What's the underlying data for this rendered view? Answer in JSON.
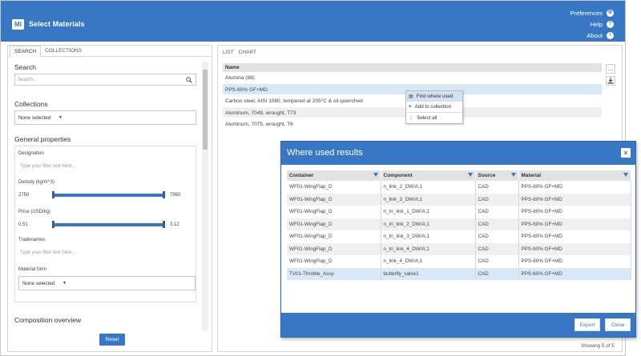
{
  "app": {
    "logo": "MI",
    "title": "Select Materials",
    "links": [
      {
        "label": "Preferences",
        "icon": "gear-icon",
        "glyph": "⚙"
      },
      {
        "label": "Help",
        "icon": "help-icon",
        "glyph": "?"
      },
      {
        "label": "About",
        "icon": "info-icon",
        "glyph": "i"
      }
    ]
  },
  "left": {
    "tabs": [
      "SEARCH",
      "COLLECTIONS"
    ],
    "search": {
      "title": "Search",
      "placeholder": "Search..."
    },
    "collections": {
      "title": "Collections",
      "value": "None selected"
    },
    "general": {
      "title": "General properties",
      "designation": {
        "label": "Designation",
        "placeholder": "Type your filter text here..."
      },
      "density": {
        "label": "Density (kg/m^3)",
        "min": "2750",
        "max": "7950"
      },
      "price": {
        "label": "Price (USD/kg)",
        "min": "0.51",
        "max": "3.12"
      },
      "tradenames": {
        "label": "Tradenames",
        "placeholder": "Type your filter text here..."
      },
      "form": {
        "label": "Material form",
        "value": "None selected"
      }
    },
    "composition": {
      "title": "Composition overview"
    },
    "reset": "Reset"
  },
  "right": {
    "tabs": [
      "LIST",
      "CHART"
    ],
    "column": "Name",
    "rows": [
      "Alumina (88)",
      "PPS-60% GF+MD",
      "Carbon steel, AISI 1080, tempered at 205°C & oil quenched",
      "Aluminum, 7049, wrought, T73",
      "Aluminum, 7075, wrought, T6"
    ],
    "context_menu": [
      "Find where used",
      "Add to collection",
      "Select all"
    ],
    "showing": "Showing 5 of 5"
  },
  "modal": {
    "title": "Where used results",
    "columns": [
      "Container",
      "Component",
      "Source",
      "Material"
    ],
    "rows": [
      [
        "WF01-WingFlap_D",
        "n_link_2_DW/A;1",
        "CAD",
        "PPS-60% GF+MD"
      ],
      [
        "WF01-WingFlap_D",
        "n_link_3_DW/A;1",
        "CAD",
        "PPS-60% GF+MD"
      ],
      [
        "WF01-WingFlap_D",
        "n_tri_link_1_DW/A;1",
        "CAD",
        "PPS-60% GF+MD"
      ],
      [
        "WF01-WingFlap_D",
        "n_tri_link_2_DW/A;1",
        "CAD",
        "PPS-60% GF+MD"
      ],
      [
        "WF01-WingFlap_D",
        "n_tri_link_3_DW/A;1",
        "CAD",
        "PPS-60% GF+MD"
      ],
      [
        "WF01-WingFlap_D",
        "n_tri_link_4_DW/A;1",
        "CAD",
        "PPS-60% GF+MD"
      ],
      [
        "WF01-WingFlap_D",
        "n_link_4_DW/A;1",
        "CAD",
        "PPS-60% GF+MD"
      ],
      [
        "TV01-Throttle_Assy",
        "butterfly_valve1",
        "CAD",
        "PPS-60% GF+MD"
      ]
    ],
    "export": "Export",
    "close": "Close",
    "close_glyph": "×"
  }
}
